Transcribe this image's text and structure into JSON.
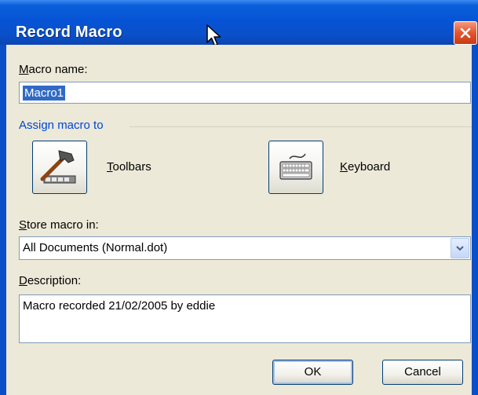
{
  "dialog": {
    "title": "Record Macro",
    "close_icon": "close-icon"
  },
  "macro_name": {
    "label_access": "M",
    "label_rest": "acro name:",
    "value": "Macro1"
  },
  "assign": {
    "group_label": "Assign macro to",
    "toolbars_access": "T",
    "toolbars_rest": "oolbars",
    "toolbars_icon": "hammer-toolbar-icon",
    "keyboard_access": "K",
    "keyboard_rest": "eyboard",
    "keyboard_icon": "keyboard-icon"
  },
  "store": {
    "label_access": "S",
    "label_rest": "tore macro in:",
    "selected": "All Documents (Normal.dot)"
  },
  "description": {
    "label_access": "D",
    "label_rest": "escription:",
    "value": "Macro recorded 21/02/2005 by eddie"
  },
  "buttons": {
    "ok": "OK",
    "cancel": "Cancel"
  },
  "colors": {
    "titlebar": "#0654d6",
    "dialog_bg": "#ece9d8",
    "group_label": "#0046d5",
    "selection": "#316ac5",
    "close": "#e5532c"
  }
}
